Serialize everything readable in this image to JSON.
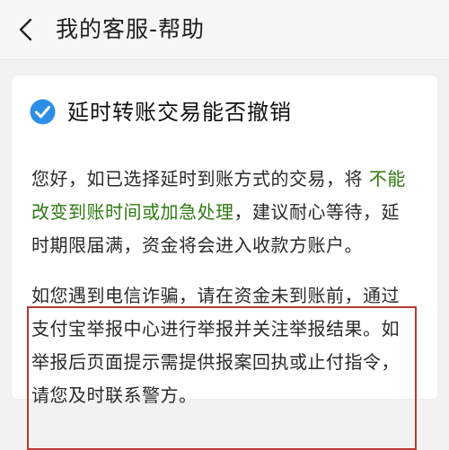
{
  "nav": {
    "back_icon": "chevron-left-icon",
    "title": "我的客服-帮助"
  },
  "question": {
    "check_icon": "check-circle-icon",
    "check_color": "#2d8ee6",
    "title": "延时转账交易能否撤销"
  },
  "answer": {
    "p1_lines": [
      {
        "a": "您好，如已选择延时到账方式的交易，将 ",
        "b": "不能"
      },
      {
        "a": "",
        "b": "改变到账时间或加急处理",
        "c": "，建议耐心等待，延"
      },
      {
        "a": "时期限届满，资金将会进入收款方账户。"
      }
    ],
    "p2_lines": [
      "如您遇到电信诈骗，请在资金未到账前，通过",
      "支付宝举报中心进行举报并关注举报结果。如",
      "举报后页面提示需提供报案回执或止付指令，",
      "请您及时联系警方。"
    ],
    "highlight_color": "#2f7a12",
    "box_color": "#b73a33"
  }
}
